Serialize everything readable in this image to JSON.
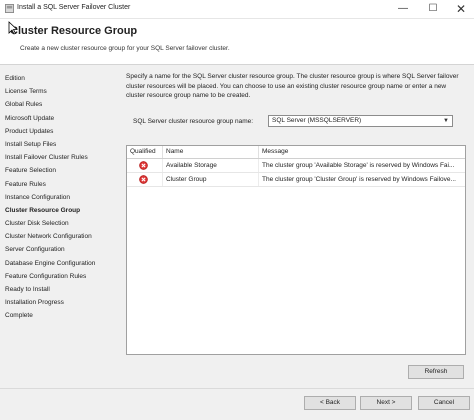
{
  "window": {
    "title": "Install a SQL Server Failover Cluster",
    "minimize_glyph": "—",
    "maximize_glyph": "☐",
    "close_glyph": "✕"
  },
  "header": {
    "title": "Cluster Resource Group",
    "subtitle": "Create a new cluster resource group for your SQL Server failover cluster."
  },
  "sidebar": {
    "items": [
      {
        "label": "Edition"
      },
      {
        "label": "License Terms"
      },
      {
        "label": "Global Rules"
      },
      {
        "label": "Microsoft Update"
      },
      {
        "label": "Product Updates"
      },
      {
        "label": "Install Setup Files"
      },
      {
        "label": "Install Failover Cluster Rules"
      },
      {
        "label": "Feature Selection"
      },
      {
        "label": "Feature Rules"
      },
      {
        "label": "Instance Configuration"
      },
      {
        "label": "Cluster Resource Group"
      },
      {
        "label": "Cluster Disk Selection"
      },
      {
        "label": "Cluster Network Configuration"
      },
      {
        "label": "Server Configuration"
      },
      {
        "label": "Database Engine Configuration"
      },
      {
        "label": "Feature Configuration Rules"
      },
      {
        "label": "Ready to Install"
      },
      {
        "label": "Installation Progress"
      },
      {
        "label": "Complete"
      }
    ],
    "active_index": 10
  },
  "main": {
    "description": "Specify a name for the SQL Server cluster resource group. The cluster resource group is where SQL Server failover cluster resources will be placed. You can choose to use an existing cluster resource group name or enter a new cluster resource group name to be created.",
    "group_label": "SQL Server cluster resource group name:",
    "group_value": "SQL Server (MSSQLSERVER)",
    "table": {
      "headers": [
        "Qualified",
        "Name",
        "Message"
      ],
      "rows": [
        {
          "name": "Available Storage",
          "message": "The cluster group 'Available Storage' is reserved by Windows Fai..."
        },
        {
          "name": "Cluster Group",
          "message": "The cluster group 'Cluster Group' is reserved by Windows Failove..."
        }
      ]
    },
    "refresh_label": "Refresh"
  },
  "footer": {
    "back_label": "< Back",
    "next_label": "Next >",
    "cancel_label": "Cancel"
  },
  "colors": {
    "error_icon": "#e03a3a"
  }
}
